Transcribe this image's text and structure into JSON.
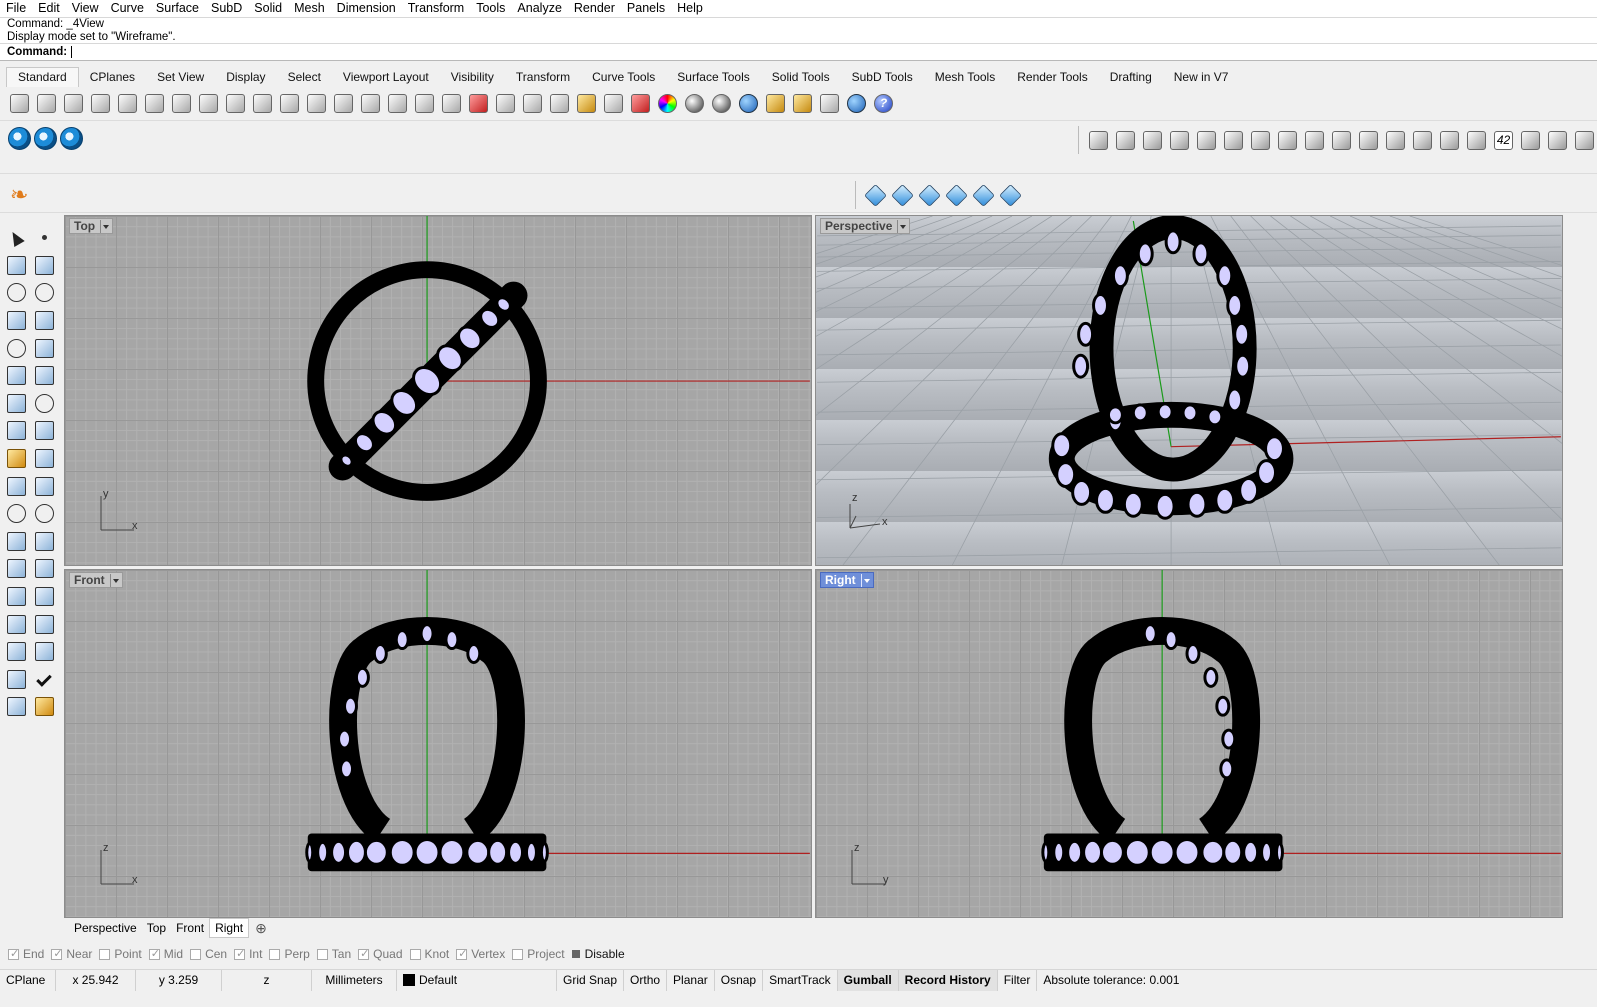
{
  "menu": [
    "File",
    "Edit",
    "View",
    "Curve",
    "Surface",
    "SubD",
    "Solid",
    "Mesh",
    "Dimension",
    "Transform",
    "Tools",
    "Analyze",
    "Render",
    "Panels",
    "Help"
  ],
  "command_history": [
    "Command: _4View",
    "Display mode set to \"Wireframe\"."
  ],
  "command_prompt": "Command:",
  "toolbar_tabs": [
    "Standard",
    "CPlanes",
    "Set View",
    "Display",
    "Select",
    "Viewport Layout",
    "Visibility",
    "Transform",
    "Curve Tools",
    "Surface Tools",
    "Solid Tools",
    "SubD Tools",
    "Mesh Tools",
    "Render Tools",
    "Drafting",
    "New in V7"
  ],
  "active_toolbar_tab": "Standard",
  "standard_toolbar_icons": [
    "new-icon",
    "open-icon",
    "save-icon",
    "print-icon",
    "import-icon",
    "cut-icon",
    "copy-icon",
    "paste-icon",
    "undo-icon",
    "pan-icon",
    "rotate-view-icon",
    "zoom-icon",
    "zoom-window-icon",
    "zoom-extents-icon",
    "zoom-selected-icon",
    "rotate-icon",
    "four-view-icon",
    "car-icon",
    "lamp-icon",
    "cplane-icon",
    "points-icon",
    "light-icon",
    "lock-icon",
    "material-icon",
    "color-wheel-icon",
    "shade-icon",
    "render-preview-icon",
    "sphere-icon",
    "pen-icon",
    "gear-icon",
    "dimension-icon",
    "globe-icon",
    "help-icon"
  ],
  "secondary_left_icons": [
    "zbrush-icon-1",
    "zbrush-icon-2",
    "zbrush-icon-3"
  ],
  "secondary_right_icons": [
    "ring-icon",
    "bail-icon",
    "gem-icon",
    "setting-icon",
    "scale-icon",
    "measure-icon",
    "ring-size-icon",
    "cluster-icon",
    "gems-icon",
    "stone-icon",
    "gold-icon",
    "chain-icon",
    "ruler-icon",
    "circle-gauge-icon",
    "dial-icon",
    "number-icon",
    "array-icon",
    "curve-icon",
    "search-icon"
  ],
  "secondary_right_number": "42",
  "third_row_icons": [
    "mesh-1-icon",
    "mesh-2-icon",
    "mesh-3-icon",
    "diamond-icon",
    "water-icon",
    "points-cube-icon"
  ],
  "viewports": {
    "top": {
      "label": "Top",
      "axis_a": "x",
      "axis_b": "y"
    },
    "perspective": {
      "label": "Perspective",
      "axis_a": "x",
      "axis_b": "z"
    },
    "front": {
      "label": "Front",
      "axis_a": "x",
      "axis_b": "z"
    },
    "right": {
      "label": "Right",
      "axis_a": "y",
      "axis_b": "z"
    }
  },
  "active_viewport": "Right",
  "viewport_tabs": [
    "Perspective",
    "Top",
    "Front",
    "Right"
  ],
  "osnaps": [
    {
      "label": "End",
      "checked": true
    },
    {
      "label": "Near",
      "checked": true
    },
    {
      "label": "Point",
      "checked": false
    },
    {
      "label": "Mid",
      "checked": true
    },
    {
      "label": "Cen",
      "checked": false
    },
    {
      "label": "Int",
      "checked": true
    },
    {
      "label": "Perp",
      "checked": false
    },
    {
      "label": "Tan",
      "checked": false
    },
    {
      "label": "Quad",
      "checked": true
    },
    {
      "label": "Knot",
      "checked": false
    },
    {
      "label": "Vertex",
      "checked": true
    },
    {
      "label": "Project",
      "checked": false
    }
  ],
  "osnap_disable": "Disable",
  "status": {
    "cplane": "CPlane",
    "x": "x 25.942",
    "y": "y 3.259",
    "z": "z",
    "units": "Millimeters",
    "layer": "Default",
    "grid_snap": "Grid Snap",
    "ortho": "Ortho",
    "planar": "Planar",
    "osnap": "Osnap",
    "smarttrack": "SmartTrack",
    "gumball": "Gumball",
    "record_history": "Record History",
    "filter": "Filter",
    "tolerance": "Absolute tolerance: 0.001"
  },
  "colors": {
    "viewport_bg": "#a6a6a6",
    "gem_fill": "#d4d0ff",
    "geometry": "#000000",
    "x_axis": "#b02020",
    "y_axis": "#1a9a1a",
    "active_label": "#6f8fd9"
  }
}
